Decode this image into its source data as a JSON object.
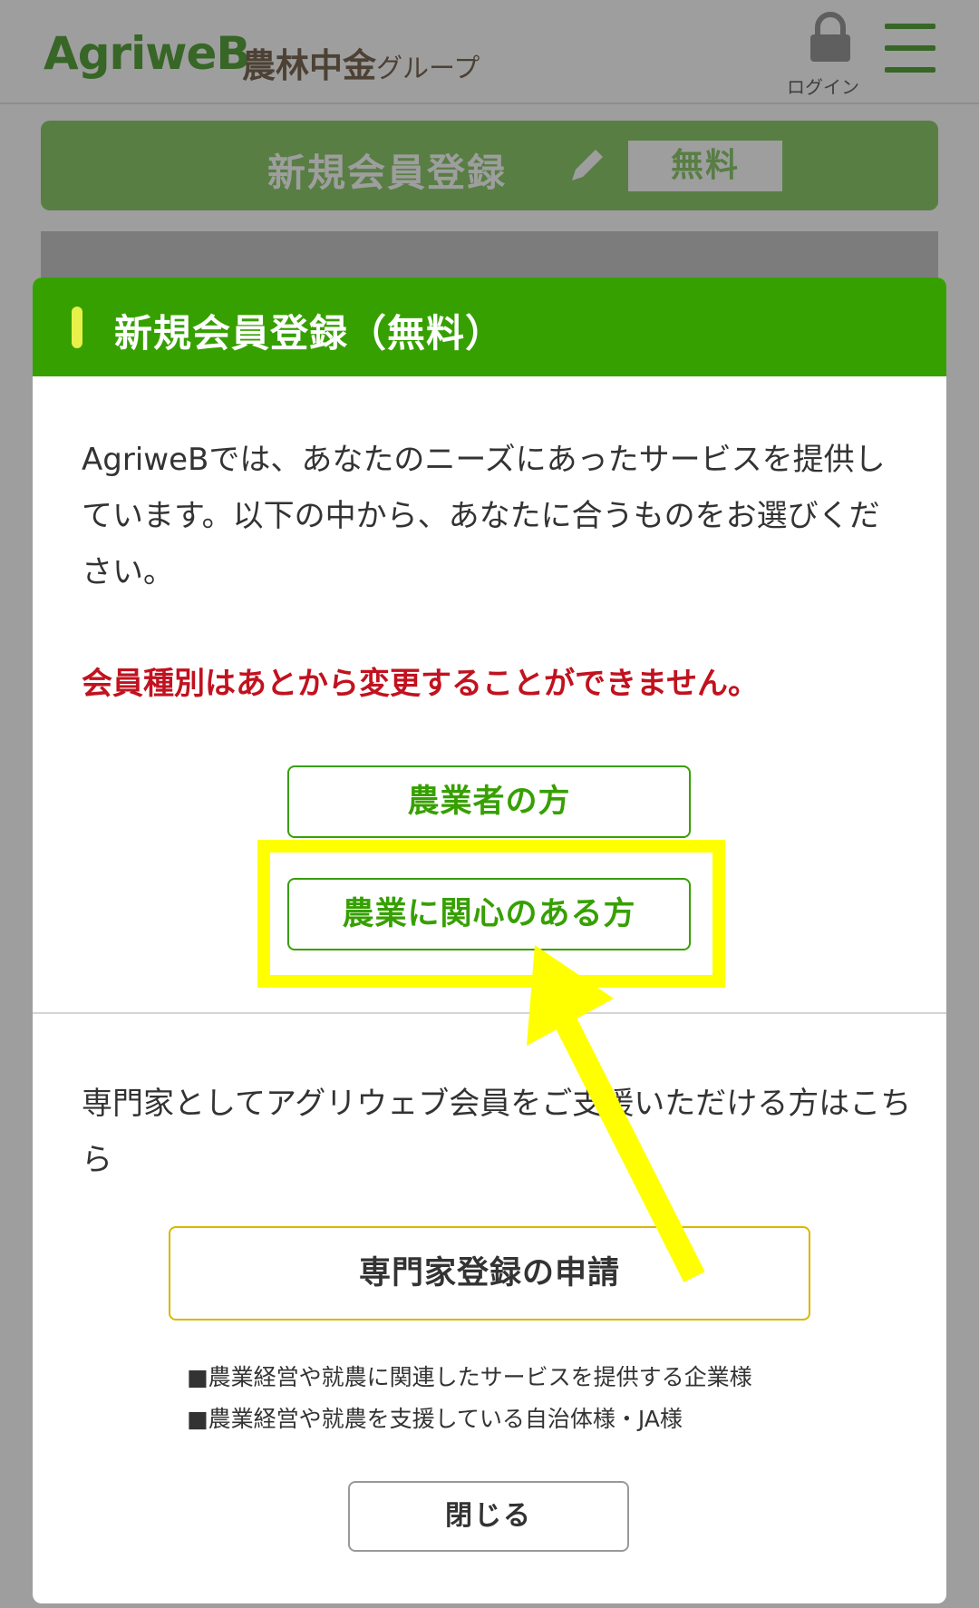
{
  "header": {
    "logo": "AgriweB",
    "group_main": "農林中金",
    "group_suffix": "グループ",
    "login_label": "ログイン"
  },
  "banner": {
    "label": "新規会員登録",
    "free_tag": "無料"
  },
  "modal": {
    "title": "新規会員登録（無料）",
    "intro": "AgriweBでは、あなたのニーズにあったサービスを提供しています。以下の中から、あなたに合うものをお選びください。",
    "warning": "会員種別はあとから変更することができません。",
    "farmer_button": "農業者の方",
    "interested_button": "農業に関心のある方",
    "expert_text": "専門家としてアグリウェブ会員をご支援いただける方はこちら",
    "expert_button": "専門家登録の申請",
    "expert_notes": [
      "■農業経営や就農に関連したサービスを提供する企業様",
      "■農業経営や就農を支援している自治体様・JA様"
    ],
    "close_button": "閉じる"
  },
  "colors": {
    "header_green": "#36a000",
    "warning_red": "#c1121f",
    "highlight_yellow": "#ffff00",
    "expert_border": "#d9b800"
  },
  "icons": {
    "login": "lock-icon",
    "menu": "hamburger-menu-icon",
    "banner": "pencil-icon"
  }
}
